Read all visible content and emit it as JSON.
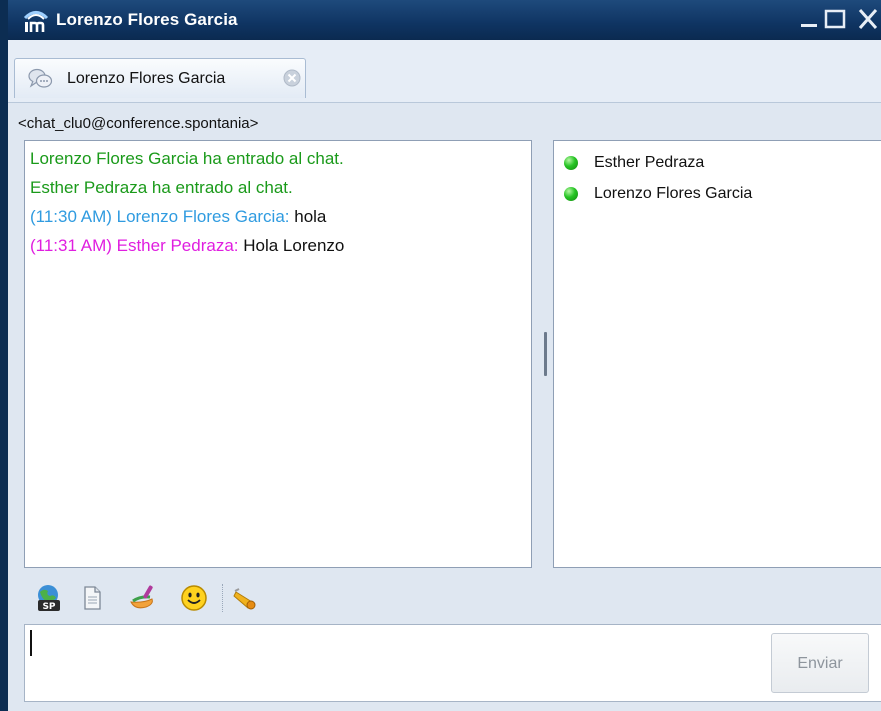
{
  "window": {
    "title": "Lorenzo Flores Garcia",
    "controls": {
      "minimize": "_",
      "maximize": "□",
      "close": "X"
    }
  },
  "tab": {
    "label": "Lorenzo Flores Garcia",
    "icon": "chat-bubbles-icon",
    "close_icon": "close-circle-icon"
  },
  "room": {
    "address": "<chat_clu0@conference.spontania>"
  },
  "messages": [
    {
      "text": "Lorenzo Flores Garcia ha entrado al chat.",
      "color": "#1a9a1a"
    },
    {
      "text": "Esther Pedraza ha entrado al chat.",
      "color": "#1a9a1a"
    },
    {
      "prefix": "(11:30 AM) Lorenzo Flores Garcia: ",
      "body": "hola",
      "color": "#2f9be0"
    },
    {
      "prefix": "(11:31 AM) Esther Pedraza: ",
      "body": "Hola Lorenzo",
      "color": "#e01ee0"
    }
  ],
  "participants": [
    {
      "name": "Esther Pedraza",
      "status": "online",
      "status_color": "#26c424"
    },
    {
      "name": "Lorenzo Flores Garcia",
      "status": "online",
      "status_color": "#26c424"
    }
  ],
  "toolbar": {
    "icons": [
      "share-desktop-icon",
      "document-icon",
      "whiteboard-icon",
      "emoticon-icon",
      "alert-horn-icon"
    ]
  },
  "composer": {
    "value": "",
    "send_label": "Enviar"
  },
  "colors": {
    "titlebar": "#0f3462",
    "join_text": "#1a9a1a",
    "self_text": "#2f9be0",
    "other_text": "#e01ee0"
  }
}
